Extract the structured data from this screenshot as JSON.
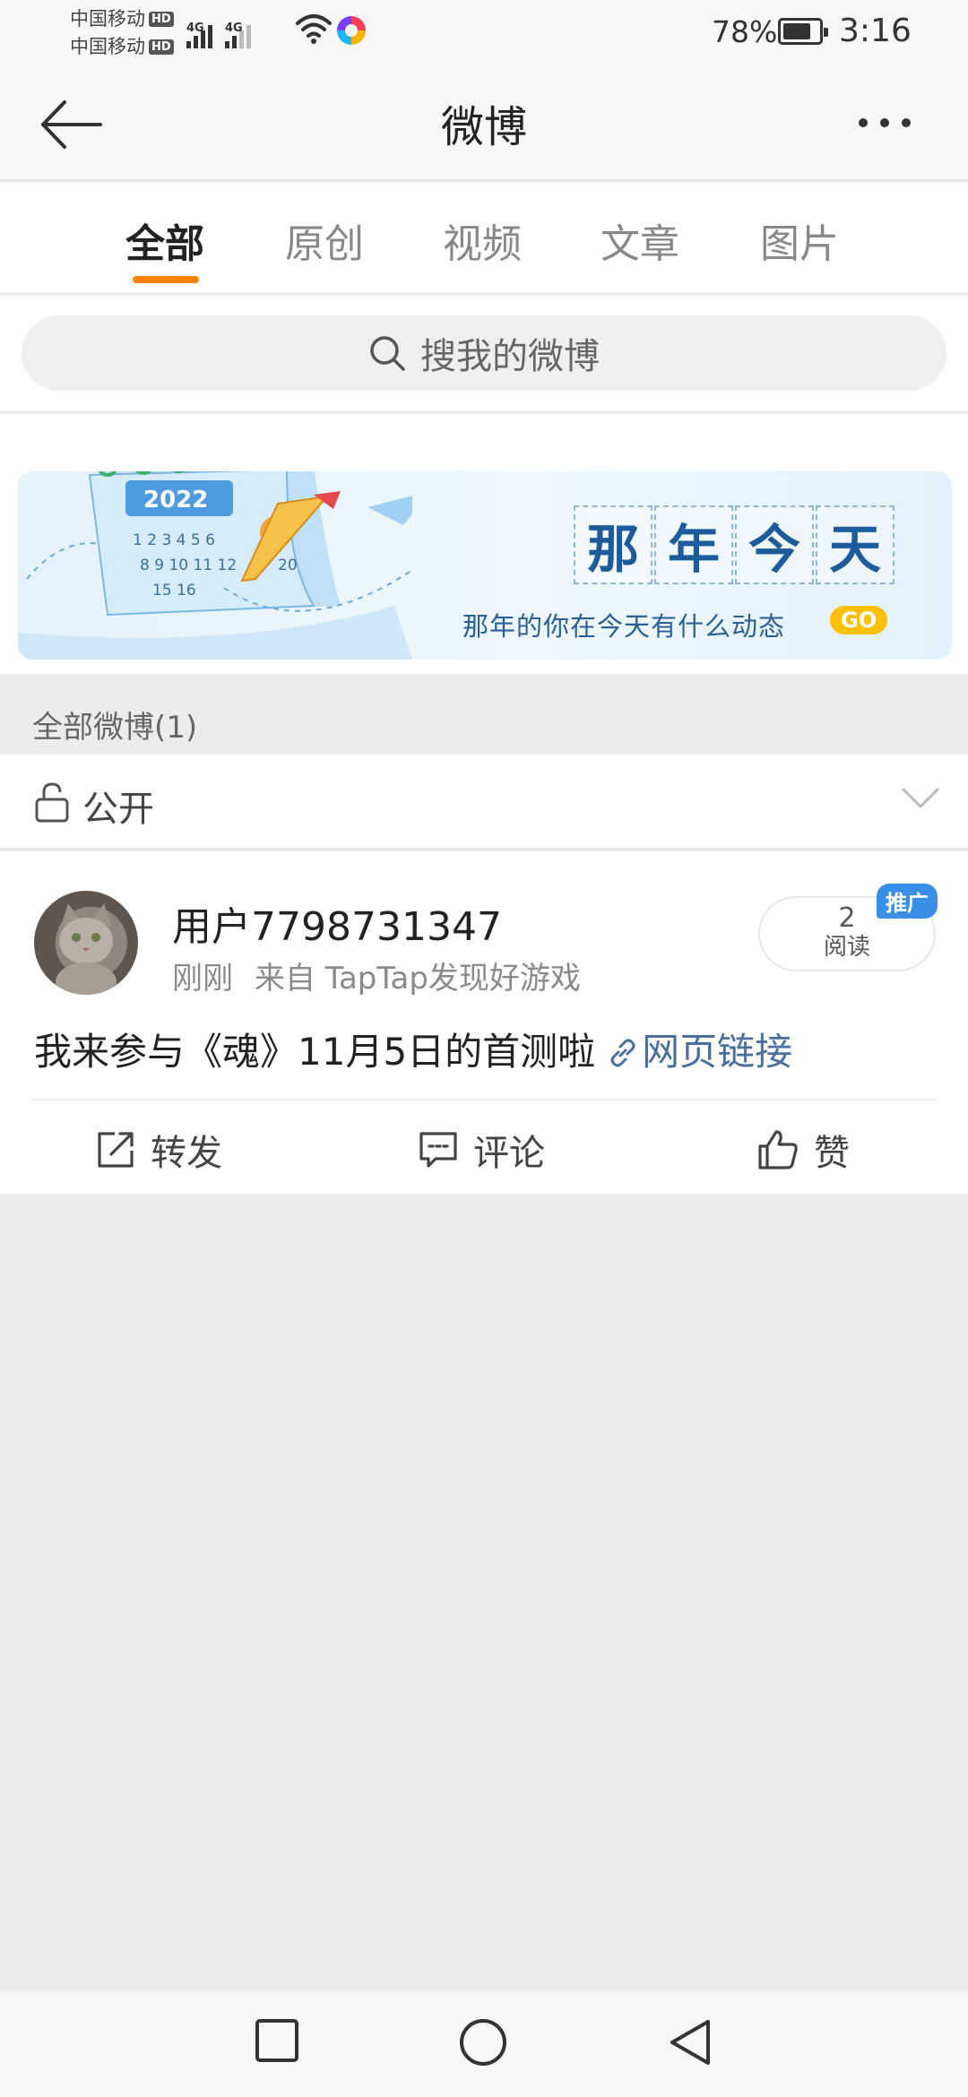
{
  "status_bar": {
    "carrier1": "中国移动",
    "carrier2": "中国移动",
    "hd_badge": "HD",
    "network1": "4G",
    "network2": "4G",
    "battery_percent": "78%",
    "battery_level": 0.78,
    "time": "3:16"
  },
  "nav": {
    "title": "微博",
    "back_icon": "arrow-left-icon",
    "more_icon": "more-dots-icon"
  },
  "tabs": [
    {
      "label": "全部",
      "active": true
    },
    {
      "label": "原创",
      "active": false
    },
    {
      "label": "视频",
      "active": false
    },
    {
      "label": "文章",
      "active": false
    },
    {
      "label": "图片",
      "active": false
    }
  ],
  "search": {
    "placeholder": "搜我的微博"
  },
  "banner": {
    "title_chars": [
      "那",
      "年",
      "今",
      "天"
    ],
    "subtitle": "那年的你在今天有什么动态",
    "go_label": "GO",
    "calendar_year": "2022"
  },
  "section": {
    "label": "全部微博(1)"
  },
  "filter": {
    "label": "公开"
  },
  "post": {
    "username": "用户7798731347",
    "time": "刚刚",
    "source": "来自 TapTap发现好游戏",
    "read_count": "2",
    "read_label": "阅读",
    "promo_badge": "推广",
    "text": "我来参与《魂》11月5日的首测啦",
    "link_text": "网页链接",
    "actions": {
      "repost": "转发",
      "comment": "评论",
      "like": "赞"
    }
  },
  "colors": {
    "accent": "#ff8200",
    "link": "#4a6f9c",
    "promo": "#3a8ee6",
    "go_button": "#ffc107"
  }
}
